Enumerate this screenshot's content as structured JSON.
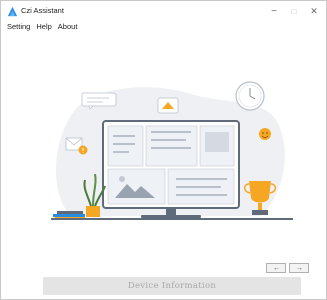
{
  "window": {
    "title": "Czi Assistant",
    "minimize_label": "−",
    "maximize_label": "□",
    "close_label": "✕"
  },
  "menu": {
    "items": [
      "Setting",
      "Help",
      "About"
    ]
  },
  "nav": {
    "back_label": "←",
    "forward_label": "→"
  },
  "footer": {
    "device_info_label": "Device Information"
  },
  "colors": {
    "accent_blue": "#2b8be0",
    "accent_orange": "#f5a623",
    "blob_gray": "#eef0f4",
    "window_border": "#c9c9c9"
  },
  "illustration": {
    "name": "dashboard-desk-illustration"
  }
}
